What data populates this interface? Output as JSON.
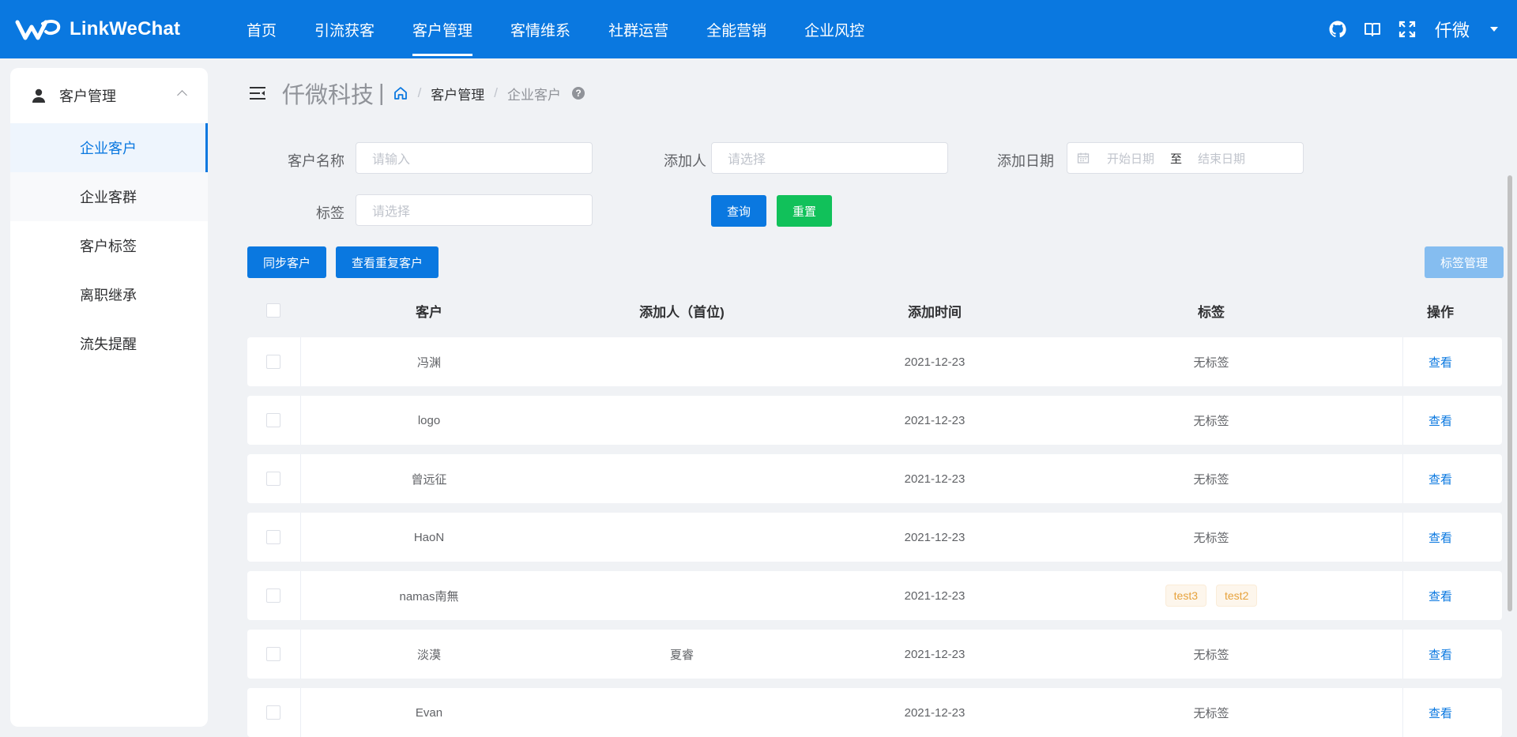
{
  "app": {
    "name": "LinkWeChat"
  },
  "topnav": [
    {
      "label": "首页",
      "active": false
    },
    {
      "label": "引流获客",
      "active": false
    },
    {
      "label": "客户管理",
      "active": true
    },
    {
      "label": "客情维系",
      "active": false
    },
    {
      "label": "社群运营",
      "active": false
    },
    {
      "label": "全能营销",
      "active": false
    },
    {
      "label": "企业风控",
      "active": false
    }
  ],
  "user": {
    "name": "仟微"
  },
  "sidebar": {
    "group_label": "客户管理",
    "items": [
      {
        "label": "企业客户",
        "active": true
      },
      {
        "label": "企业客群",
        "active": false
      },
      {
        "label": "客户标签",
        "active": false
      },
      {
        "label": "离职继承",
        "active": false
      },
      {
        "label": "流失提醒",
        "active": false
      }
    ]
  },
  "breadcrumb": {
    "company": "仟微科技",
    "divider": "|",
    "level1": "客户管理",
    "level2": "企业客户",
    "help": "?"
  },
  "filters": {
    "customer_name": {
      "label": "客户名称",
      "placeholder": "请输入"
    },
    "adder": {
      "label": "添加人",
      "placeholder": "请选择"
    },
    "date": {
      "label": "添加日期",
      "start_placeholder": "开始日期",
      "separator": "至",
      "end_placeholder": "结束日期"
    },
    "tag": {
      "label": "标签",
      "placeholder": "请选择"
    },
    "search_label": "查询",
    "reset_label": "重置"
  },
  "actions": {
    "sync_label": "同步客户",
    "duplicates_label": "查看重复客户",
    "tag_manage_label": "标签管理"
  },
  "table": {
    "headers": {
      "customer": "客户",
      "adder": "添加人（首位)",
      "time": "添加时间",
      "tags": "标签",
      "ops": "操作"
    },
    "rows": [
      {
        "customer": "冯渊",
        "adder": "",
        "time": "2021-12-23",
        "no_tag": "无标签",
        "tags": [],
        "op": "查看"
      },
      {
        "customer": "logo",
        "adder": "",
        "time": "2021-12-23",
        "no_tag": "无标签",
        "tags": [],
        "op": "查看"
      },
      {
        "customer": "曾远征",
        "adder": "",
        "time": "2021-12-23",
        "no_tag": "无标签",
        "tags": [],
        "op": "查看"
      },
      {
        "customer": "HaoN",
        "adder": "",
        "time": "2021-12-23",
        "no_tag": "无标签",
        "tags": [],
        "op": "查看"
      },
      {
        "customer": "namas南無",
        "adder": "",
        "time": "2021-12-23",
        "no_tag": "",
        "tags": [
          "test3",
          "test2"
        ],
        "op": "查看"
      },
      {
        "customer": "淡漠",
        "adder": "夏睿",
        "time": "2021-12-23",
        "no_tag": "无标签",
        "tags": [],
        "op": "查看"
      },
      {
        "customer": "Evan",
        "adder": "",
        "time": "2021-12-23",
        "no_tag": "无标签",
        "tags": [],
        "op": "查看"
      }
    ]
  },
  "colors": {
    "primary": "#0a78e0",
    "success": "#11c15a",
    "tag_text": "#e6a23c"
  }
}
